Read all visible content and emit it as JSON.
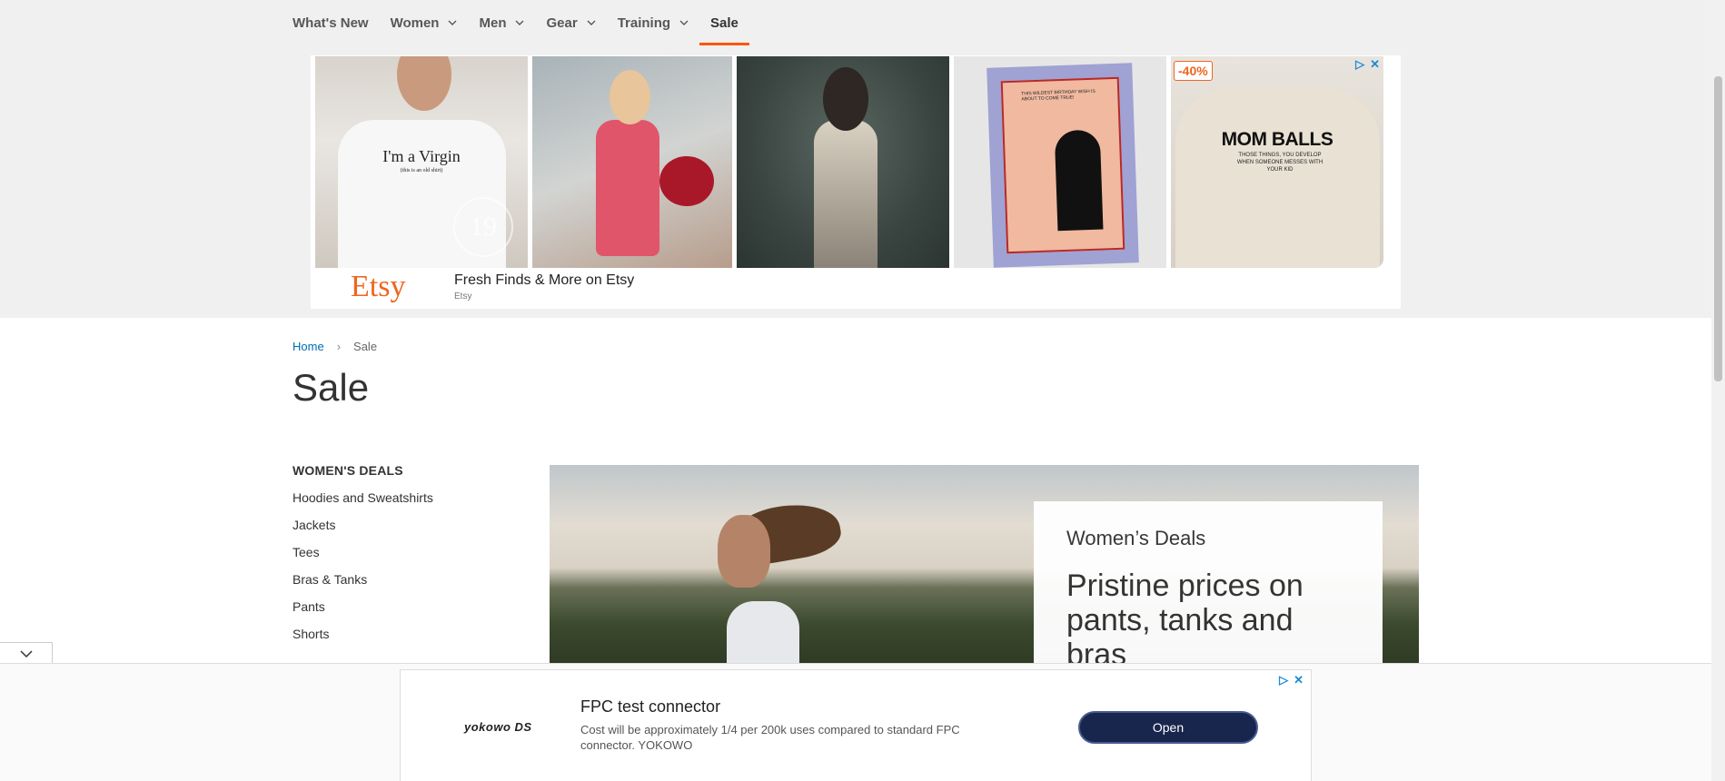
{
  "nav": {
    "items": [
      {
        "label": "What's New",
        "dropdown": false
      },
      {
        "label": "Women",
        "dropdown": true
      },
      {
        "label": "Men",
        "dropdown": true
      },
      {
        "label": "Gear",
        "dropdown": true
      },
      {
        "label": "Training",
        "dropdown": true
      },
      {
        "label": "Sale",
        "dropdown": false,
        "active": true
      }
    ],
    "accent": "#ff5501"
  },
  "top_ad": {
    "image1_text": "I'm a Virgin",
    "image1_subtext": "(this is an old shirt)",
    "image1_badge": "19",
    "image4_caption": "THIS WILDEST BIRTHDAY WISH IS ABOUT TO COME TRUE!",
    "image5_text": "MOM BALLS",
    "image5_subtext": "THOSE THINGS, YOU DEVELOP WHEN SOMEONE MESSES WITH YOUR KID",
    "discount": "-40%",
    "logo": "Etsy",
    "headline": "Fresh Finds & More on Etsy",
    "brand": "Etsy",
    "brand_color": "#f1641e"
  },
  "breadcrumb": {
    "home": "Home",
    "current": "Sale"
  },
  "page_title": "Sale",
  "sidebar": {
    "heading": "WOMEN'S DEALS",
    "items": [
      "Hoodies and Sweatshirts",
      "Jackets",
      "Tees",
      "Bras & Tanks",
      "Pants",
      "Shorts"
    ]
  },
  "hero": {
    "kicker": "Women’s Deals",
    "headline": "Pristine prices on pants, tanks and bras"
  },
  "bottom_ad": {
    "logo": "yokowo DS",
    "title": "FPC test connector",
    "description": "Cost will be approximately 1/4 per 200k uses compared to standard FPC connector. YOKOWO",
    "cta": "Open",
    "cta_color": "#18254d"
  }
}
